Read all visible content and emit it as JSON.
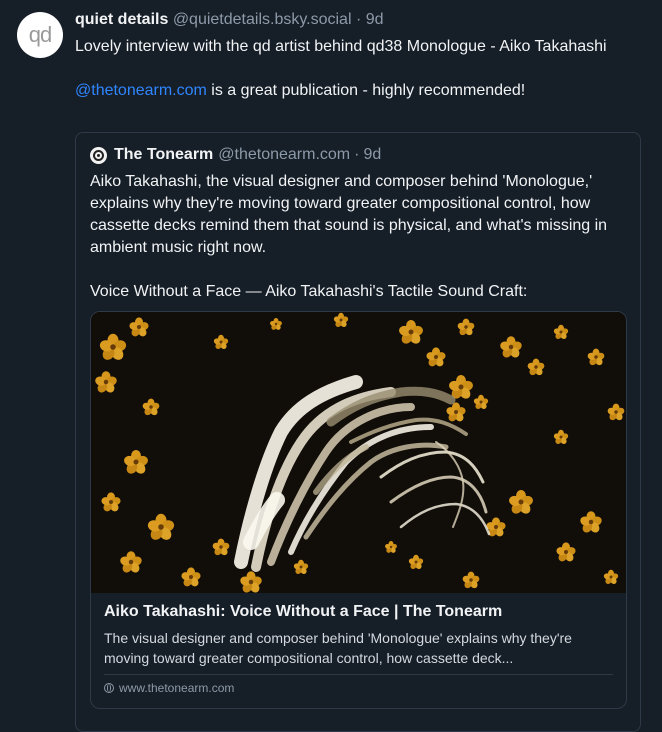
{
  "post": {
    "avatar_text": "qd",
    "author_name": "quiet details",
    "author_handle": "@quietdetails.bsky.social",
    "separator": "·",
    "time": "9d",
    "text_line1": "Lovely interview with the qd artist behind qd38 Monologue - Aiko Takahashi",
    "mention": "@thetonearm.com",
    "text_line2_rest": " is a great publication - highly recommended!"
  },
  "quote": {
    "author_name": "The Tonearm",
    "author_handle": "@thetonearm.com",
    "separator": "·",
    "time": "9d",
    "paragraph1": "Aiko Takahashi, the visual designer and composer behind 'Monologue,' explains why they're moving toward greater compositional control, how cassette decks remind them that sound is physical, and what's missing in ambient music right now.",
    "paragraph2": "Voice Without a Face — Aiko Takahashi's Tactile Sound Craft:",
    "embed": {
      "title": "Aiko Takahashi: Voice Without a Face | The Tonearm",
      "description": "The visual designer and composer behind 'Monologue' explains why they're moving toward greater compositional control, how cassette deck...",
      "domain": "www.thetonearm.com"
    }
  },
  "colors": {
    "background": "#161e27",
    "mention": "#2f86ff",
    "muted": "#8d9aa9",
    "border": "#2e3a48",
    "flower_yellow": "#e2a01e"
  },
  "icons": {
    "globe": "globe-icon",
    "avatar_quote": "tonearm-logo-icon"
  }
}
